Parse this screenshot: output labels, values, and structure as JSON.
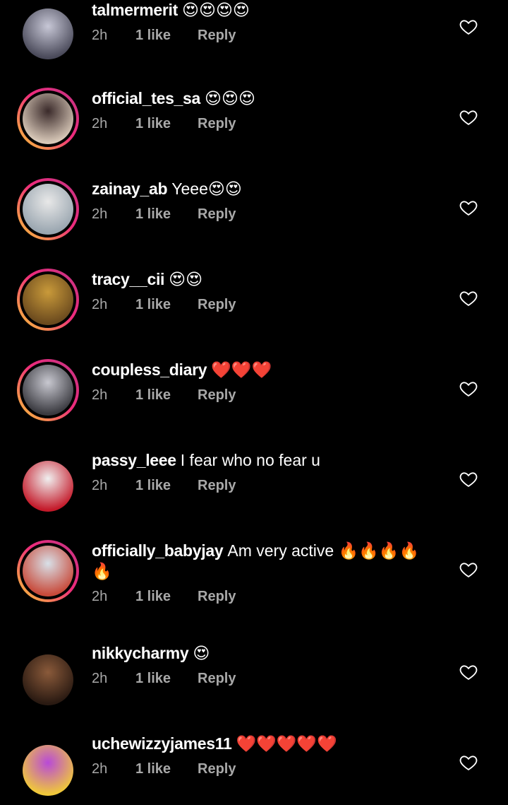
{
  "comments": [
    {
      "username": "talmermerit",
      "text": "😍😍😍😍",
      "time": "2h",
      "likes": "1 like",
      "reply": "Reply",
      "story": false,
      "avatar_colors": [
        "#c7c7d6",
        "#4a4a5a"
      ]
    },
    {
      "username": "official_tes_sa",
      "text": "😍😍😍",
      "time": "2h",
      "likes": "1 like",
      "reply": "Reply",
      "story": true,
      "avatar_colors": [
        "#3a2a2a",
        "#d8c8b8"
      ]
    },
    {
      "username": "zainay_ab",
      "text": "Yeee😍😍",
      "time": "2h",
      "likes": "1 like",
      "reply": "Reply",
      "story": true,
      "avatar_colors": [
        "#e8e8e8",
        "#9aa6b0"
      ]
    },
    {
      "username": "tracy__cii",
      "text": "😍😍",
      "time": "2h",
      "likes": "1 like",
      "reply": "Reply",
      "story": true,
      "avatar_colors": [
        "#c99a3a",
        "#6b4a1e"
      ]
    },
    {
      "username": "coupless_diary",
      "text": "❤️❤️❤️",
      "time": "2h",
      "likes": "1 like",
      "reply": "Reply",
      "story": true,
      "avatar_colors": [
        "#c8c8d0",
        "#3a3a40"
      ]
    },
    {
      "username": "passy_leee",
      "text": "I fear who no fear u",
      "time": "2h",
      "likes": "1 like",
      "reply": "Reply",
      "story": false,
      "avatar_colors": [
        "#f0f0f0",
        "#c41a2a"
      ]
    },
    {
      "username": "officially_babyjay",
      "text": "Am very active 🔥🔥🔥🔥🔥",
      "time": "2h",
      "likes": "1 like",
      "reply": "Reply",
      "story": true,
      "avatar_colors": [
        "#d8e0e8",
        "#c84a3a"
      ]
    },
    {
      "username": "nikkycharmy",
      "text": "😍",
      "time": "2h",
      "likes": "1 like",
      "reply": "Reply",
      "story": false,
      "avatar_colors": [
        "#8a5a3a",
        "#2a1a12"
      ]
    },
    {
      "username": "uchewizzyjames11",
      "text": "❤️❤️❤️❤️❤️",
      "time": "2h",
      "likes": "1 like",
      "reply": "Reply",
      "story": false,
      "avatar_colors": [
        "#b84ad8",
        "#f0c83a"
      ]
    }
  ]
}
